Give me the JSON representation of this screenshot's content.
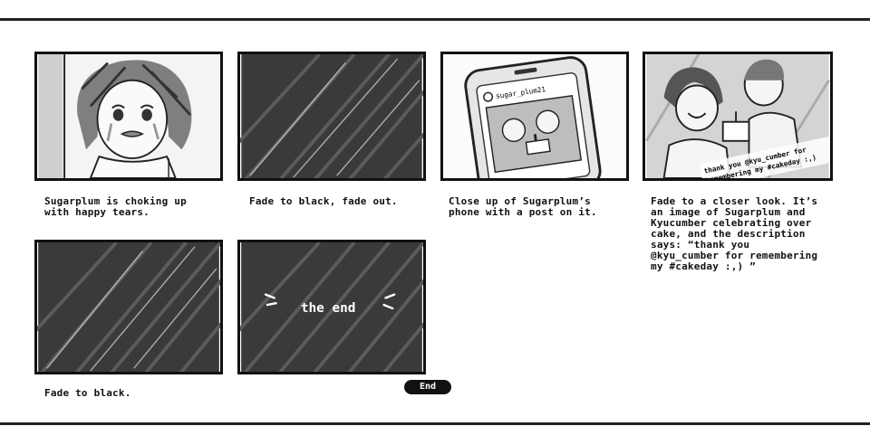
{
  "panels": [
    {
      "caption": "Sugarplum is choking up\nwith happy tears."
    },
    {
      "caption": "Fade to black, fade out."
    },
    {
      "caption": "Close up of Sugarplum’s\nphone with a post on it.",
      "phone_handle": "sugar_plum21"
    },
    {
      "caption": "Fade to a closer look. It’s\nan image of Sugarplum and\nKyucumber celebrating over\ncake, and the description\nsays: “thank you\n@kyu_cumber for remembering\nmy #cakeday :,) ”",
      "overlay_line_1": "thank you @kyu_cumber for",
      "overlay_line_2": "remembering my #cakeday :,)"
    },
    {
      "caption": "Fade to black."
    },
    {
      "caption": "",
      "screen_text": "the end"
    }
  ],
  "end_label": "End"
}
